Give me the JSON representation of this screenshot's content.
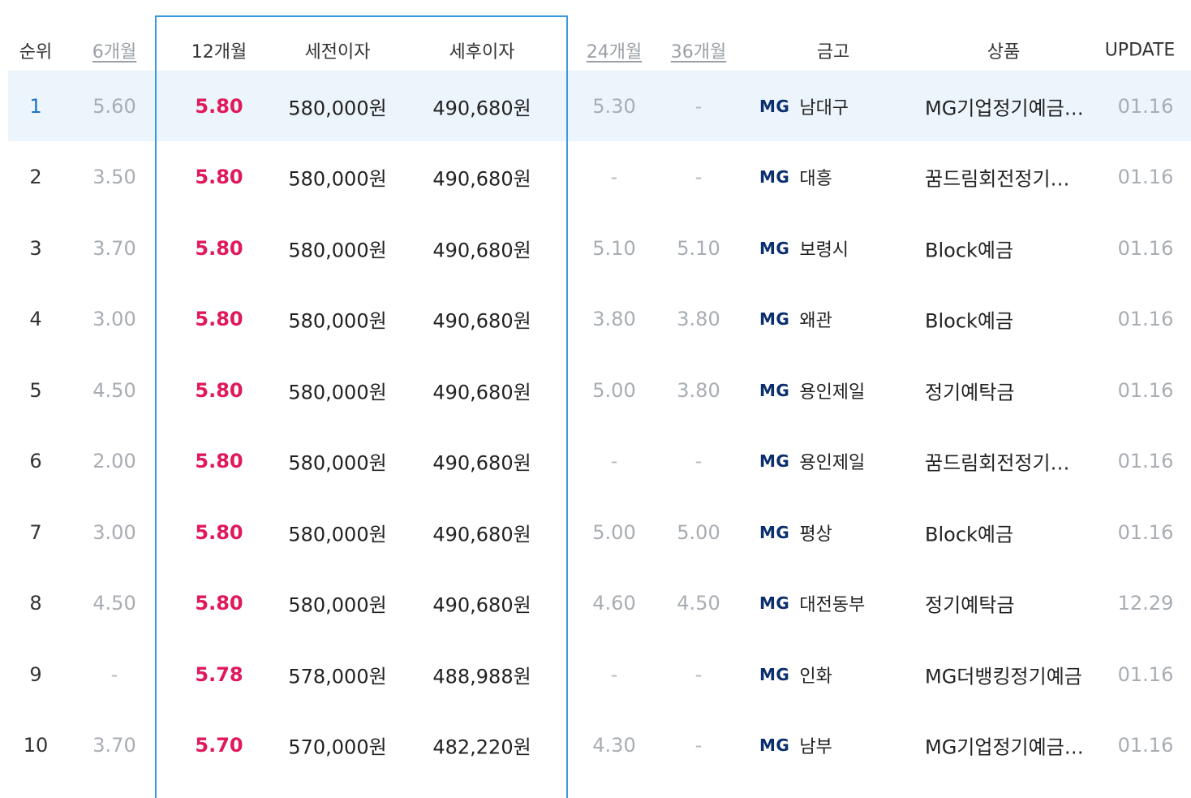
{
  "headers": {
    "rank": "순위",
    "m6": "6개월",
    "m12": "12개월",
    "pre_tax": "세전이자",
    "post_tax": "세후이자",
    "m24": "24개월",
    "m36": "36개월",
    "bank": "금고",
    "product": "상품",
    "update": "UPDATE"
  },
  "colors": {
    "accent_rate": "#e0195a",
    "highlight_border": "#3a9ae0",
    "highlight_row": "#edf5fc",
    "mg_brand": "#0a2e6e"
  },
  "rows": [
    {
      "rank": "1",
      "m6": "5.60",
      "m12": "5.80",
      "pre_tax": "580,000원",
      "post_tax": "490,680원",
      "m24": "5.30",
      "m36": "-",
      "mg": "MG",
      "bank": "남대구",
      "product": "MG기업정기예금…",
      "update": "01.16"
    },
    {
      "rank": "2",
      "m6": "3.50",
      "m12": "5.80",
      "pre_tax": "580,000원",
      "post_tax": "490,680원",
      "m24": "-",
      "m36": "-",
      "mg": "MG",
      "bank": "대흥",
      "product": "꿈드림회전정기…",
      "update": "01.16"
    },
    {
      "rank": "3",
      "m6": "3.70",
      "m12": "5.80",
      "pre_tax": "580,000원",
      "post_tax": "490,680원",
      "m24": "5.10",
      "m36": "5.10",
      "mg": "MG",
      "bank": "보령시",
      "product": "Block예금",
      "update": "01.16"
    },
    {
      "rank": "4",
      "m6": "3.00",
      "m12": "5.80",
      "pre_tax": "580,000원",
      "post_tax": "490,680원",
      "m24": "3.80",
      "m36": "3.80",
      "mg": "MG",
      "bank": "왜관",
      "product": "Block예금",
      "update": "01.16"
    },
    {
      "rank": "5",
      "m6": "4.50",
      "m12": "5.80",
      "pre_tax": "580,000원",
      "post_tax": "490,680원",
      "m24": "5.00",
      "m36": "3.80",
      "mg": "MG",
      "bank": "용인제일",
      "product": "정기예탁금",
      "update": "01.16"
    },
    {
      "rank": "6",
      "m6": "2.00",
      "m12": "5.80",
      "pre_tax": "580,000원",
      "post_tax": "490,680원",
      "m24": "-",
      "m36": "-",
      "mg": "MG",
      "bank": "용인제일",
      "product": "꿈드림회전정기…",
      "update": "01.16"
    },
    {
      "rank": "7",
      "m6": "3.00",
      "m12": "5.80",
      "pre_tax": "580,000원",
      "post_tax": "490,680원",
      "m24": "5.00",
      "m36": "5.00",
      "mg": "MG",
      "bank": "평상",
      "product": "Block예금",
      "update": "01.16"
    },
    {
      "rank": "8",
      "m6": "4.50",
      "m12": "5.80",
      "pre_tax": "580,000원",
      "post_tax": "490,680원",
      "m24": "4.60",
      "m36": "4.50",
      "mg": "MG",
      "bank": "대전동부",
      "product": "정기예탁금",
      "update": "12.29"
    },
    {
      "rank": "9",
      "m6": "-",
      "m12": "5.78",
      "pre_tax": "578,000원",
      "post_tax": "488,988원",
      "m24": "-",
      "m36": "-",
      "mg": "MG",
      "bank": "인화",
      "product": "MG더뱅킹정기예금",
      "update": "01.16"
    },
    {
      "rank": "10",
      "m6": "3.70",
      "m12": "5.70",
      "pre_tax": "570,000원",
      "post_tax": "482,220원",
      "m24": "4.30",
      "m36": "-",
      "mg": "MG",
      "bank": "남부",
      "product": "MG기업정기예금…",
      "update": "01.16"
    }
  ]
}
